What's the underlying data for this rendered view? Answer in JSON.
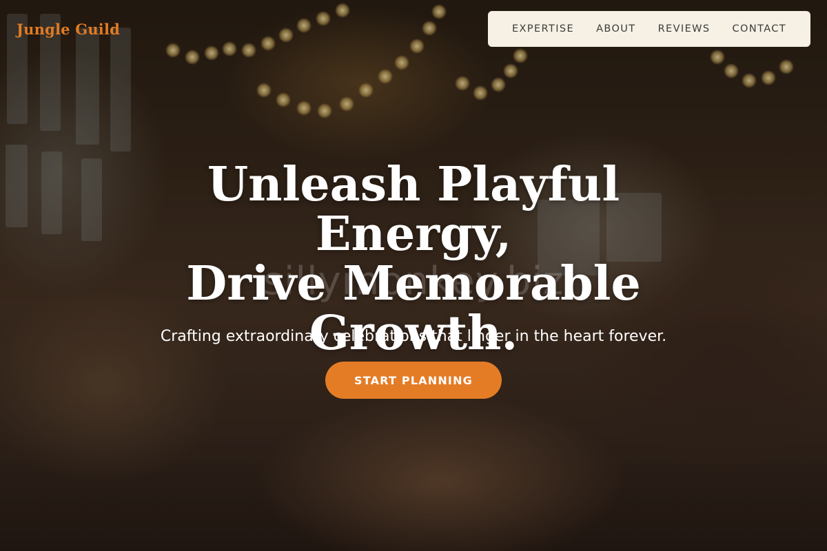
{
  "brand": {
    "logo_text": "Jungle Guild",
    "accent_color": "#e47c26"
  },
  "nav": {
    "items": [
      {
        "label": "EXPERTISE"
      },
      {
        "label": "ABOUT"
      },
      {
        "label": "REVIEWS"
      },
      {
        "label": "CONTACT"
      }
    ]
  },
  "hero": {
    "headline_line1": "Unleash Playful Energy,",
    "headline_line2": "Drive Memorable",
    "headline_line3": "Growth.",
    "subtitle": "Crafting extraordinary celebrations that linger in the heart forever.",
    "cta_label": "START PLANNING",
    "watermark": "sillymonkey.biz",
    "background_image": "party-celebration-photo"
  }
}
